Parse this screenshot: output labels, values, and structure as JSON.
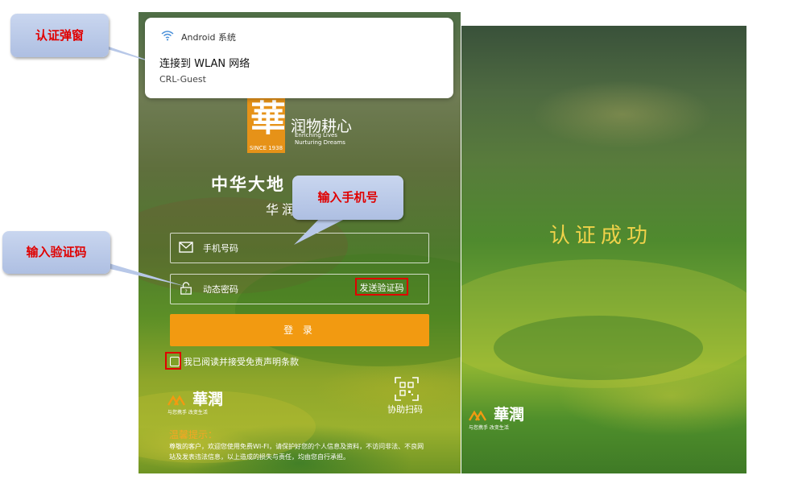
{
  "notification": {
    "source": "Android 系统",
    "title": "连接到 WLAN 网络",
    "ssid": "CRL-Guest",
    "icon": "wifi-icon"
  },
  "login": {
    "logo_since": "SINCE 1938",
    "slogan": "润物耕心",
    "slogan_en_line1": "Enriching Lives",
    "slogan_en_line2": "Nurturing Dreams",
    "headline": "中华大地",
    "subhead": "华润",
    "phone_placeholder": "手机号码",
    "code_placeholder": "动态密码",
    "send_code_label": "发送验证码",
    "login_button": "登 录",
    "agree_text": "我已阅读并接受免责声明条款",
    "brand": "華潤",
    "brand_tag": "与您携手 改变生活",
    "qr_label": "协助扫码",
    "tips_title": "温馨提示：",
    "tips_body": "尊敬的客户，欢迎您使用免费WI-FI，请保护好您的个人信息及资料，不访问非法、不良网站及发表违法信息，以上造成的损失与责任，均由您自行承担。"
  },
  "success": {
    "text": "认证成功",
    "brand": "華潤",
    "brand_tag": "与您携手 改变生活"
  },
  "callouts": {
    "popup": "认证弹窗",
    "phone": "输入手机号",
    "code": "输入验证码"
  },
  "colors": {
    "accent_orange": "#f29a11",
    "highlight_red": "#e00000",
    "callout_blue": "#b8c8e8",
    "success_gold": "#f0d24a"
  }
}
